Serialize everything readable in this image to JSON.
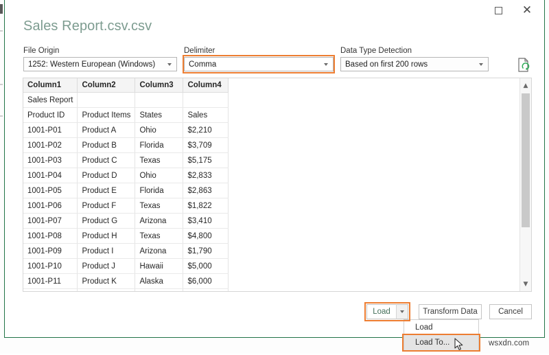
{
  "window": {
    "maximize_icon": "maximize-icon",
    "close_icon": "close-icon"
  },
  "dialog": {
    "title": "Sales Report.csv.csv",
    "accent_color": "#ED7D31",
    "border_color": "#217346"
  },
  "fields": {
    "file_origin": {
      "label": "File Origin",
      "value": "1252: Western European (Windows)"
    },
    "delimiter": {
      "label": "Delimiter",
      "value": "Comma",
      "highlighted": true
    },
    "data_type_detection": {
      "label": "Data Type Detection",
      "value": "Based on first 200 rows"
    },
    "refresh_icon": "file-refresh-icon"
  },
  "preview": {
    "columns": [
      "Column1",
      "Column2",
      "Column3",
      "Column4"
    ],
    "rows": [
      [
        "Sales Report",
        "",
        "",
        ""
      ],
      [
        "Product ID",
        "Product Items",
        "States",
        "Sales"
      ],
      [
        "1001-P01",
        "Product A",
        "Ohio",
        "$2,210"
      ],
      [
        "1001-P02",
        "Product B",
        "Florida",
        "$3,709"
      ],
      [
        "1001-P03",
        "Product C",
        "Texas",
        "$5,175"
      ],
      [
        "1001-P04",
        "Product D",
        "Ohio",
        "$2,833"
      ],
      [
        "1001-P05",
        "Product E",
        "Florida",
        "$2,863"
      ],
      [
        "1001-P06",
        "Product F",
        "Texas",
        "$1,822"
      ],
      [
        "1001-P07",
        "Product G",
        "Arizona",
        "$3,410"
      ],
      [
        "1001-P08",
        "Product H",
        "Texas",
        "$4,800"
      ],
      [
        "1001-P09",
        "Product I",
        "Arizona",
        "$1,790"
      ],
      [
        "1001-P10",
        "Product J",
        "Hawaii",
        "$5,000"
      ],
      [
        "1001-P11",
        "Product K",
        "Alaska",
        "$6,000"
      ],
      [
        "",
        "",
        "",
        ""
      ]
    ],
    "scrollbar": {
      "up_arrow": "chevron-up-icon",
      "down_arrow": "chevron-down-icon"
    }
  },
  "buttons": {
    "load": "Load",
    "load_dropdown_icon": "chevron-down-icon",
    "transform_data": "Transform Data",
    "cancel": "Cancel"
  },
  "load_menu": {
    "items": [
      {
        "label": "Load",
        "hovered": false
      },
      {
        "label": "Load To...",
        "hovered": true
      }
    ]
  },
  "watermark": "wsxdn.com"
}
